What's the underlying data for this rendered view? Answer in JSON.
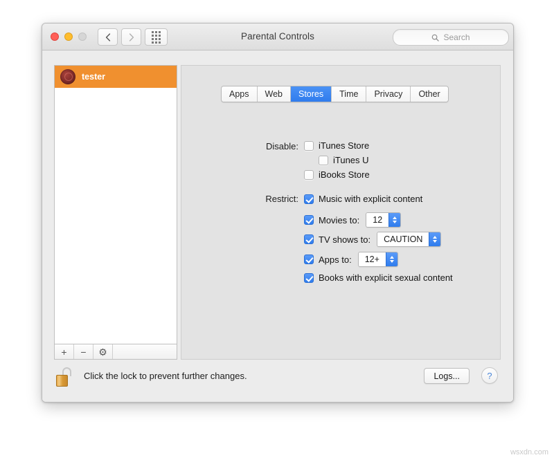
{
  "window": {
    "title": "Parental Controls",
    "traffic_lights": [
      "close",
      "minimize",
      "zoom"
    ],
    "nav": {
      "back_icon": "chevron-left-icon",
      "forward_icon": "chevron-right-icon",
      "showall_icon": "grid-icon"
    },
    "search": {
      "placeholder": "Search",
      "icon": "search-icon"
    }
  },
  "sidebar": {
    "users": [
      {
        "name": "tester",
        "selected": true,
        "avatar_icon": "user-avatar-rose"
      }
    ],
    "footer_buttons": [
      {
        "name": "add-user",
        "glyph": "+"
      },
      {
        "name": "remove-user",
        "glyph": "−"
      },
      {
        "name": "settings",
        "glyph": "⚙"
      }
    ]
  },
  "tabs": [
    {
      "label": "Apps",
      "active": false
    },
    {
      "label": "Web",
      "active": false
    },
    {
      "label": "Stores",
      "active": true
    },
    {
      "label": "Time",
      "active": false
    },
    {
      "label": "Privacy",
      "active": false
    },
    {
      "label": "Other",
      "active": false
    }
  ],
  "stores_panel": {
    "disable_label": "Disable:",
    "disable_items": [
      {
        "label": "iTunes Store",
        "checked": false,
        "indented": false
      },
      {
        "label": "iTunes U",
        "checked": false,
        "indented": true
      },
      {
        "label": "iBooks Store",
        "checked": false,
        "indented": false
      }
    ],
    "restrict_label": "Restrict:",
    "restrict_items": [
      {
        "label": "Music with explicit content",
        "checked": true,
        "stepper": null
      },
      {
        "label": "Movies to:",
        "checked": true,
        "stepper": "12"
      },
      {
        "label": "TV shows to:",
        "checked": true,
        "stepper": "CAUTION"
      },
      {
        "label": "Apps to:",
        "checked": true,
        "stepper": "12+"
      },
      {
        "label": "Books with explicit sexual content",
        "checked": true,
        "stepper": null
      }
    ]
  },
  "bottom_bar": {
    "lock_icon": "unlocked-padlock-icon",
    "lock_text": "Click the lock to prevent further changes.",
    "logs_label": "Logs...",
    "help_label": "?"
  },
  "watermark": "wsxdn.com",
  "colors": {
    "accent_blue": "#2f7ced",
    "selection_orange": "#f0902f",
    "window_grey": "#ececec",
    "panel_grey": "#e3e3e3"
  }
}
